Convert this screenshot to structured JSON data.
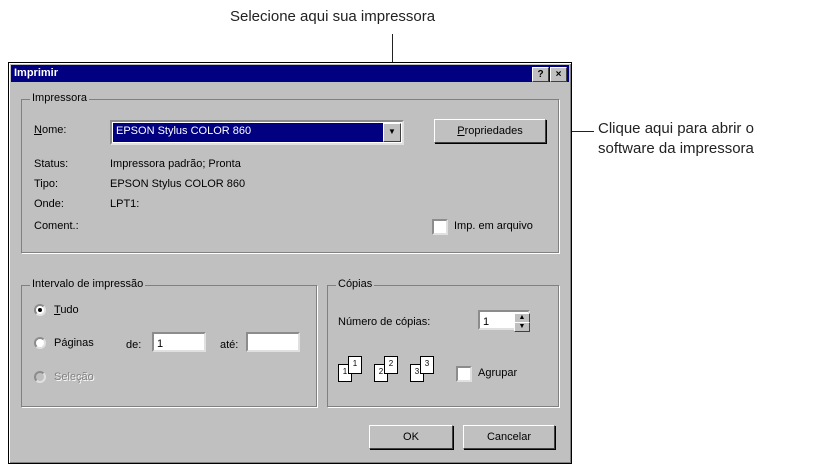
{
  "callouts": {
    "printer_select": "Selecione aqui sua impressora",
    "properties_line1": "Clique aqui para abrir o",
    "properties_line2": "software da impressora"
  },
  "dialog": {
    "title": "Imprimir",
    "help_button": "?",
    "close_button": "×",
    "printer_group": {
      "label": "Impressora",
      "name_label_u": "N",
      "name_label_rest": "ome:",
      "name_value": "EPSON Stylus COLOR 860",
      "properties_u": "P",
      "properties_rest": "ropriedades",
      "status_label": "Status:",
      "status_value": "Impressora padrão; Pronta",
      "type_label": "Tipo:",
      "type_value": "EPSON Stylus COLOR 860",
      "where_label": "Onde:",
      "where_value": "LPT1:",
      "comment_label": "Coment.:",
      "print_to_file": "Imp. em arquivo"
    },
    "range_group": {
      "label": "Intervalo de impressão",
      "all_u": "T",
      "all_rest": "udo",
      "pages_label": "Páginas",
      "from_label": "de:",
      "from_value": "1",
      "to_label": "até:",
      "to_value": "",
      "selection_label": "Seleção"
    },
    "copies_group": {
      "label": "Cópias",
      "number_label": "Número de cópias:",
      "number_value": "1",
      "collate_label": "Agrupar",
      "page_icons": [
        "1",
        "1",
        "2",
        "2",
        "3",
        "3"
      ]
    },
    "ok_label": "OK",
    "cancel_label": "Cancelar"
  }
}
